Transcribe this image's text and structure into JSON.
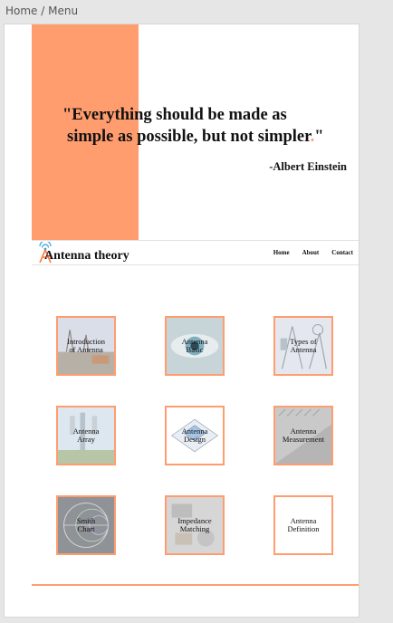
{
  "breadcrumb": "Home / Menu",
  "hero": {
    "quote_line1": "\"Everything should be made as",
    "quote_line2_text": "simple as possible, but not simpler",
    "quote_dot": ".",
    "quote_close": "\"",
    "author": "-Albert Einstein"
  },
  "nav": {
    "brand": "Antenna theory",
    "logo_icon": "antenna-tower-icon",
    "links": [
      "Home",
      "About",
      "Contact"
    ]
  },
  "tiles": [
    {
      "line1": "Introduction",
      "line2": "of Antenna"
    },
    {
      "line1": "Antenna",
      "line2": "Basic"
    },
    {
      "line1": "Types of",
      "line2": "Antenna"
    },
    {
      "line1": "Antenna",
      "line2": "Array"
    },
    {
      "line1": "Antenna",
      "line2": "Design"
    },
    {
      "line1": "Antenna",
      "line2": "Measurement"
    },
    {
      "line1": "Smith",
      "line2": "Chart"
    },
    {
      "line1": "Impedance",
      "line2": "Matching"
    },
    {
      "line1": "Antenna",
      "line2": "Definition"
    }
  ],
  "colors": {
    "accent": "#ff9d6f"
  }
}
